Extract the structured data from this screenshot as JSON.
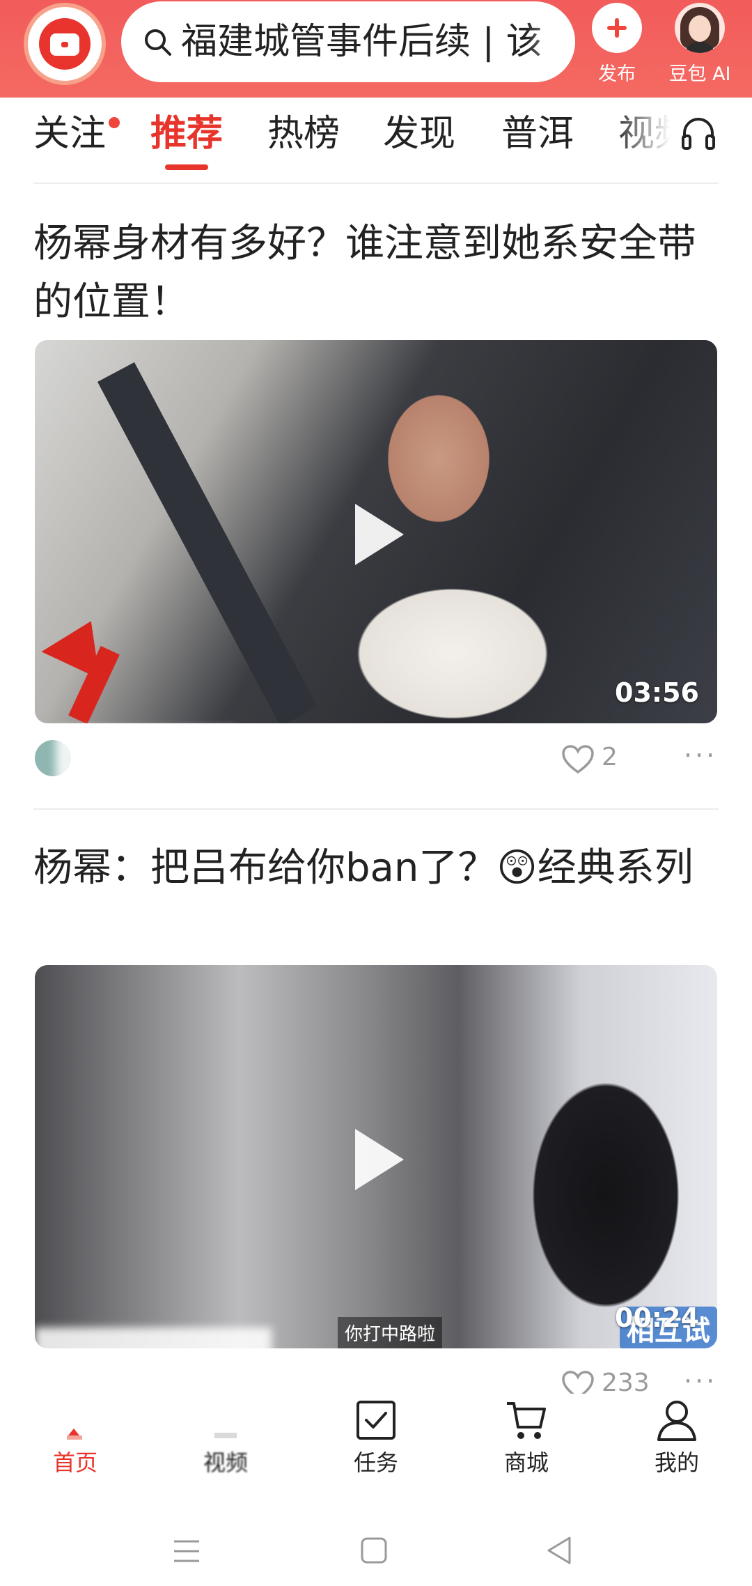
{
  "header": {
    "search_query": "福建城管事件后续 | 该",
    "publish_label": "发布",
    "ai_label": "豆包 AI"
  },
  "tabs": [
    "关注",
    "推荐",
    "热榜",
    "发现",
    "普洱",
    "视频"
  ],
  "active_tab": "推荐",
  "feed": [
    {
      "title": "杨幂身材有多好？谁注意到她系安全带的位置！",
      "duration": "03:56",
      "likes": "2"
    },
    {
      "title": "杨幂：把吕布给你ban了？😲经典系列",
      "duration": "00:24",
      "likes": "233",
      "subtitle_caption": "你打中路啦",
      "show_tag": "相互试"
    }
  ],
  "bottom_nav": [
    "首页",
    "视频",
    "任务",
    "商城",
    "我的"
  ],
  "active_nav": "首页",
  "colors": {
    "brand_red": "#e8352c",
    "header_bg": "#f25b5b"
  }
}
